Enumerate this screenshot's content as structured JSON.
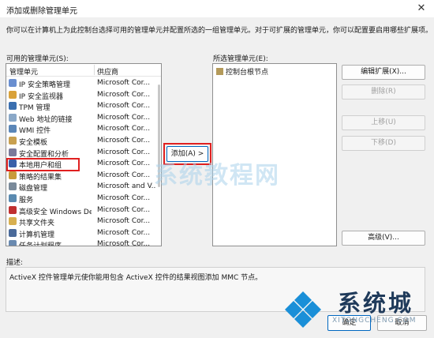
{
  "dialog": {
    "title": "添加或删除管理单元",
    "close_glyph": "✕",
    "intro": "你可以在计算机上为此控制台选择可用的管理单元并配置所选的一组管理单元。对于可扩展的管理单元，你可以配置要启用哪些扩展项。"
  },
  "available": {
    "label": "可用的管理单元(S):",
    "col_name": "管理单元",
    "col_vendor": "供应商",
    "items": [
      {
        "name": "IP 安全策略管理",
        "vendor": "Microsoft Cor...",
        "icon": "#6a8fd0"
      },
      {
        "name": "IP 安全监视器",
        "vendor": "Microsoft Cor...",
        "icon": "#d9a23a"
      },
      {
        "name": "TPM 管理",
        "vendor": "Microsoft Cor...",
        "icon": "#3a6fb0"
      },
      {
        "name": "Web 地址的链接",
        "vendor": "Microsoft Cor...",
        "icon": "#8aa8c8"
      },
      {
        "name": "WMI 控件",
        "vendor": "Microsoft Cor...",
        "icon": "#5a86b8"
      },
      {
        "name": "安全模板",
        "vendor": "Microsoft Cor...",
        "icon": "#c8a050"
      },
      {
        "name": "安全配置和分析",
        "vendor": "Microsoft Cor...",
        "icon": "#7a7a9a"
      },
      {
        "name": "本地用户和组",
        "vendor": "Microsoft Cor...",
        "icon": "#3a5fa8"
      },
      {
        "name": "策略的结果集",
        "vendor": "Microsoft Cor...",
        "icon": "#c89a3a"
      },
      {
        "name": "磁盘管理",
        "vendor": "Microsoft and V...",
        "icon": "#7a8a9a"
      },
      {
        "name": "服务",
        "vendor": "Microsoft Cor...",
        "icon": "#5a8ab0"
      },
      {
        "name": "高级安全 Windows De...",
        "vendor": "Microsoft Cor...",
        "icon": "#c03030"
      },
      {
        "name": "共享文件夹",
        "vendor": "Microsoft Cor...",
        "icon": "#d8b050"
      },
      {
        "name": "计算机管理",
        "vendor": "Microsoft Cor...",
        "icon": "#4a6a9a"
      },
      {
        "name": "任务计划程序",
        "vendor": "Microsoft Cor...",
        "icon": "#6a8ab0"
      }
    ]
  },
  "add_button": "添加(A) >",
  "selected": {
    "label": "所选管理单元(E):",
    "items": [
      "控制台根节点"
    ]
  },
  "right_buttons": {
    "edit_ext": "编辑扩展(X)...",
    "remove": "删除(R)",
    "move_up": "上移(U)",
    "move_down": "下移(D)",
    "advanced": "高级(V)..."
  },
  "description": {
    "label": "描述:",
    "text": "ActiveX 控件管理单元使你能用包含 ActiveX 控件的结果视图添加 MMC 节点。"
  },
  "footer": {
    "ok": "确定",
    "cancel": "取消"
  },
  "watermarks": {
    "center": "系统教程网",
    "logo_text": "系统城",
    "logo_sub": "XITONGCHENG.COM"
  },
  "colors": {
    "highlight_box": "#e02020",
    "accent": "#0067c0"
  }
}
